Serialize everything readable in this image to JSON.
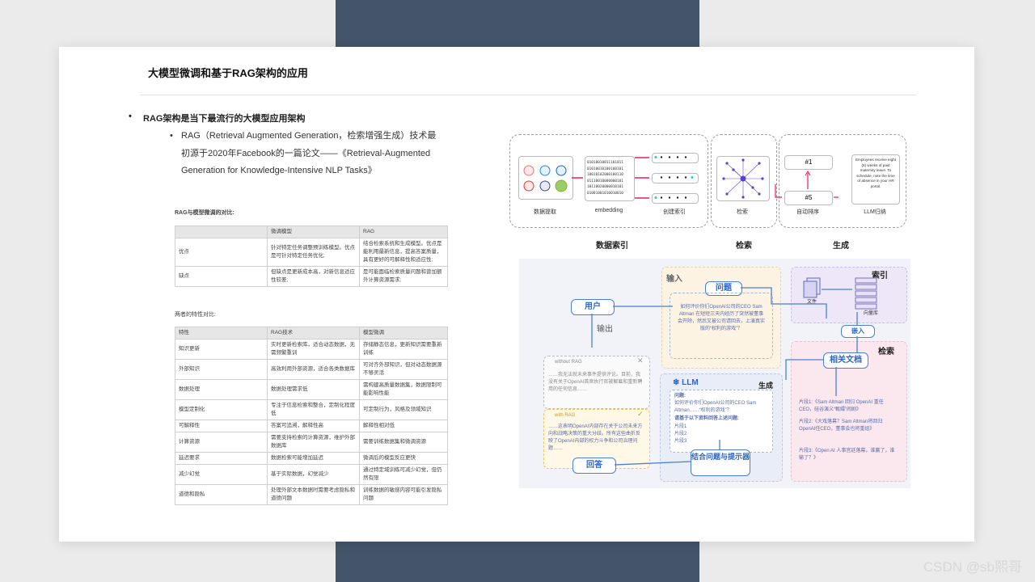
{
  "slide": {
    "title": "大模型微调和基于RAG架构的应用",
    "bullet1": "RAG架构是当下最流行的大模型应用架构",
    "bullet2": "RAG（Retrieval Augmented Generation，检索增强生成）技术最初源于2020年Facebook的一篇论文——《Retrieval-Augmented Generation for Knowledge-Intensive NLP Tasks》"
  },
  "compare": {
    "heading": "RAG与模型微调的对比:",
    "headers": [
      "",
      "微调模型",
      "RAG"
    ],
    "rows": [
      [
        "优点",
        "针对特定任务调整预训练模型。优点是可针对特定任务优化;",
        "结合检索系统和生成模型。优点是能利用最新信息，提高答案质量，具有更好的可解释性和适应性;"
      ],
      [
        "缺点",
        "但缺点是更新成本高，对新信息适应性较差;",
        "是可能面临检索质量问题和曾加额外计算资源需求;"
      ]
    ]
  },
  "features": {
    "heading": "两者的特性对比:",
    "headers": [
      "特性",
      "RAG技术",
      "模型微调"
    ],
    "rows": [
      [
        "知识更新",
        "实时更新检索库，适合动态数据，无需频繁重训",
        "存储静态信息，更新知识需要重新训练"
      ],
      [
        "外部知识",
        "高效利用外部资源，适合各类数据库",
        "可对齐外部知识，但对动态数据源不够灵活"
      ],
      [
        "数据处理",
        "数据处理需求低",
        "需构建高质量数据集，数据限制可能影响性能"
      ],
      [
        "模型定制化",
        "专注于信息检索和整合，定制化程度低",
        "可定制行为，风格及领域知识"
      ],
      [
        "可解释性",
        "答案可追溯，解释性高",
        "解释性相对低"
      ],
      [
        "计算资源",
        "需要支持检索的计算资源，维护外部数据库",
        "需要训练数据集和微调资源"
      ],
      [
        "延迟要求",
        "数据检索可能增加延迟",
        "微调后的模型反应更快"
      ],
      [
        "减少幻觉",
        "基于实际数据，幻觉减少",
        "通过特定域训练可减少幻觉，但仍然有限"
      ],
      [
        "道德和隐私",
        "处理外部文本数据时需要考虑隐私和道德问题",
        "训练数据的敏感内容可能引发隐私问题"
      ]
    ]
  },
  "pipeline": {
    "nodes": [
      "数据提取",
      "embedding",
      "创建索引",
      "检索",
      "自动排序",
      "LLM归纳"
    ],
    "stages": [
      "数据索引",
      "检索",
      "生成"
    ],
    "binary": [
      "01010010011101011",
      "01010010100100101",
      "10010102000100110",
      "01110010000000101",
      "10110020000010101",
      "01001001010010010"
    ],
    "rank": [
      "#1",
      "#5"
    ],
    "llm_text": "Employees receive eight (8) weeks of paid maternity leave. To schedule, note the time of absence in your HR portal."
  },
  "flow": {
    "input": "输入",
    "question": "问题",
    "question_text": "如何评价你们OpenAI公司的CEO Sam Altman 在短短三天内经历了突然被董事会开除，然后又被公司请回去，上演真实版的“权利的游戏”？",
    "user": "用户",
    "output": "输出",
    "index": "索引",
    "file": "文件",
    "vector_db": "向量库",
    "embed": "嵌入",
    "retrieve": "检索",
    "related": "相关文档",
    "without_rag": "without RAG",
    "without_text": "……我无法就未来事件提供评论。目前，我没有关于OpenAI首席执行官被解雇和重新聘用的任何信息……",
    "with_rag": "with RAG",
    "with_text": "……这表明OpenAI内部存在关于公司未来方向和战略决策的重大分歧。所有这些曲折反映了OpenAI内部的权力斗争和公司治理问题……",
    "llm": "LLM",
    "generate": "生成",
    "prompt_q": "问题:",
    "prompt_q_text": "如何评价你们OpenAI公司的CEO Sam Altman……“权利的游戏”？",
    "prompt_inst": "请基于以下资料回答上述问题:",
    "prompt_chunks": [
      "片段1",
      "片段2",
      "片段3"
    ],
    "combine": "结合问题与提示器",
    "answer": "回答",
    "docs": [
      "片段1:《Sam Altman 回归 OpenAI 重任CEO，硅谷演义“甄嬛”闹剧》",
      "片段2:《大戏落幕？Sam Altman将回归OpenAI任CEO，董事会也将重组》",
      "片段3:《Open AI 人事宫廷落幕，谁赢了，谁输了？》"
    ]
  },
  "watermark": "CSDN @sb熙哥"
}
